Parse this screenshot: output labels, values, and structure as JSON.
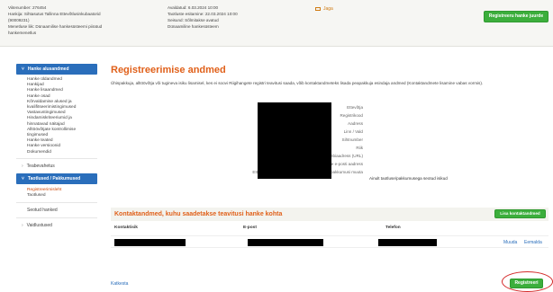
{
  "header": {
    "col1": [
      "Viitenumber: 276454",
      "Hankija: Sihtasutus Tallinna Ettevõtlusinkubaatorid",
      "(90009231)",
      "Menetluse liik: Dünaamilise hankesüsteemi piiratud",
      "hankemenetlus"
    ],
    "col2": [
      "Avaldatud: 6.03.2024 10:00",
      "Taotluste esitamine: 22.03.2024 10:00",
      "Seisund: Sõlmitakse avatud",
      "Dünaamiline hankesüsteem"
    ],
    "share_label": "Jaga",
    "register_suitable_button": "Registreeru hanke juurde"
  },
  "sidebar": {
    "section1_title": "Hanke alusandmed",
    "section1_items": [
      "Hanke üldandmed",
      "Hankijad",
      "Hanke lisaandmed",
      "Hanke osad",
      "Kõrvaldamise alused ja",
      "kvalifitseerimistingimused",
      "Vastavustingimused",
      "Hindamiskriteeriumid ja",
      "hinnatavad näitajad",
      "Alltöövõtjate kontrollimise",
      "tingimused",
      "Hanke teated",
      "Hanke versioonid",
      "Dokumendid"
    ],
    "section2_title": "Teabevahetus",
    "section3_title": "Taotlused / Pakkumused",
    "section3_items": [
      "Registreerimisleht",
      "Taotlused"
    ],
    "section4_title": "Seotud hanked",
    "section5_title": "Vaidlustused"
  },
  "main": {
    "title": "Registreerimise andmed",
    "intro": "Ühispakkuja, alltöövõtja või tugineva isiku lisamisel, kes ei soovi Riigihangete registri teavitusi saada, võib kontaktandmeteks lisada peapakkuja esindaja andmed (Kontaktandmete lisamine vabas vormis).",
    "form_labels": [
      "Ettevõtja",
      "Registrikood",
      "Aadress",
      "Linn / Vald",
      "Sihtnumber",
      "Riik",
      "Üldine veebiaadress (URL)",
      "Üldine e-posti aadress",
      "Ettevõtja posti nõusolek ja saavad taotlusi/pakkumusi muuta"
    ],
    "consent_value": "Ainult taotluse/pakkumusega seotud isikud",
    "contacts_title": "Kontaktandmed, kuhu saadetakse teavitusi hanke kohta",
    "add_contact_button": "Lisa kontaktandmed",
    "table_headers": [
      "Kontaktisik",
      "E-post",
      "Telefon"
    ],
    "row_actions": [
      "Muuda",
      "Eemalda"
    ],
    "cancel_link": "Katkesta",
    "register_button": "Registreeri"
  },
  "colors": {
    "accent_orange": "#e0601a",
    "primary_blue": "#2a6ebb",
    "button_green": "#3cae3c",
    "highlight_red": "#d42a2a"
  }
}
